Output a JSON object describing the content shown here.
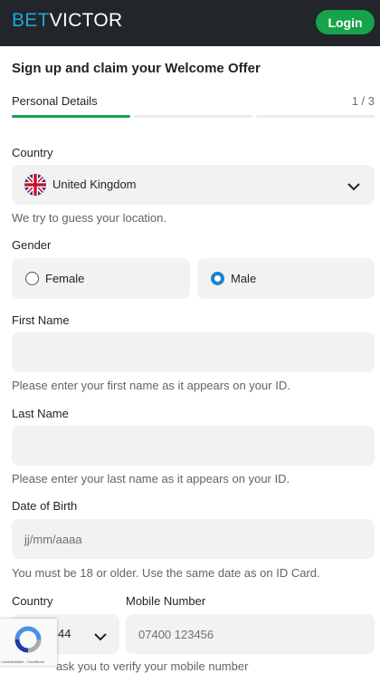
{
  "header": {
    "logo_bet": "BET",
    "logo_victor": "VICTOR",
    "login_label": "Login"
  },
  "form": {
    "title": "Sign up and claim your Welcome Offer",
    "step_label": "Personal Details",
    "step_count": "1 / 3",
    "country": {
      "label": "Country",
      "value": "United Kingdom",
      "flag": "uk-flag-icon",
      "hint": "We try to guess your location."
    },
    "gender": {
      "label": "Gender",
      "options": [
        "Female",
        "Male"
      ],
      "selected": "Male"
    },
    "first_name": {
      "label": "First Name",
      "value": "",
      "hint": "Please enter your first name as it appears on your ID."
    },
    "last_name": {
      "label": "Last Name",
      "value": "",
      "hint": "Please enter your last name as it appears on your ID."
    },
    "dob": {
      "label": "Date of Birth",
      "placeholder": "jj/mm/aaaa",
      "hint": "You must be 18 or older. Use the same date as on ID Card."
    },
    "phone": {
      "country_label": "Country",
      "code_value": "44",
      "mobile_label": "Mobile Number",
      "mobile_placeholder": "07400 123456",
      "hint": "ask you to verify your mobile number"
    }
  },
  "recaptcha": {
    "links": "Confidentialité - Conditions"
  },
  "colors": {
    "topbar": "#22252a",
    "accent_green": "#16a34a",
    "logo_blue": "#1ea7d7",
    "radio_blue": "#1a84c6",
    "field_bg": "#f2f2f2"
  }
}
